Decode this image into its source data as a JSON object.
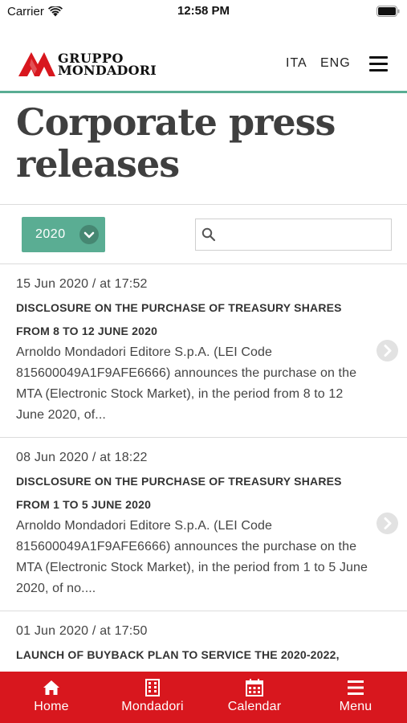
{
  "status_bar": {
    "carrier": "Carrier",
    "time": "12:58 PM"
  },
  "header": {
    "logo_line1": "GRUPPO",
    "logo_line2": "MONDADORI",
    "lang_ita": "ITA",
    "lang_eng": "ENG"
  },
  "page": {
    "title": "Corporate press releases"
  },
  "filters": {
    "year": "2020",
    "search_value": "",
    "search_placeholder": ""
  },
  "press_releases": [
    {
      "date": "15 Jun 2020 / at 17:52",
      "title": "DISCLOSURE ON THE PURCHASE OF TREASURY SHARES FROM 8 TO 12 JUNE 2020",
      "summary": "Arnoldo Mondadori Editore S.p.A. (LEI Code 815600049A1F9AFE6666) announces the purchase on the MTA (Electronic Stock Market), in the period from 8 to 12 June 2020, of..."
    },
    {
      "date": "08 Jun 2020 / at 18:22",
      "title": "DISCLOSURE ON THE PURCHASE OF TREASURY SHARES FROM 1 TO 5 JUNE 2020",
      "summary": "Arnoldo Mondadori Editore S.p.A. (LEI Code 815600049A1F9AFE6666) announces the purchase on the MTA (Electronic Stock Market), in the period from 1 to 5 June 2020, of no...."
    },
    {
      "date": "01 Jun 2020 / at 17:50",
      "title": "LAUNCH OF BUYBACK PLAN TO SERVICE THE 2020-2022,",
      "summary": ""
    }
  ],
  "tab_bar": {
    "home": "Home",
    "mondadori": "Mondadori",
    "calendar": "Calendar",
    "menu": "Menu"
  },
  "colors": {
    "accent_green": "#5aad93",
    "brand_red": "#d8171e"
  },
  "icons": {
    "wifi": "wifi-icon",
    "battery": "battery-icon",
    "logo_mark": "mondadori-logo-icon",
    "hamburger": "hamburger-menu-icon",
    "chevron": "chevron-down-icon",
    "search": "search-icon",
    "arrow": "chevron-right-icon",
    "home": "home-icon",
    "building": "building-icon",
    "calendar": "calendar-icon",
    "menu": "menu-icon"
  }
}
